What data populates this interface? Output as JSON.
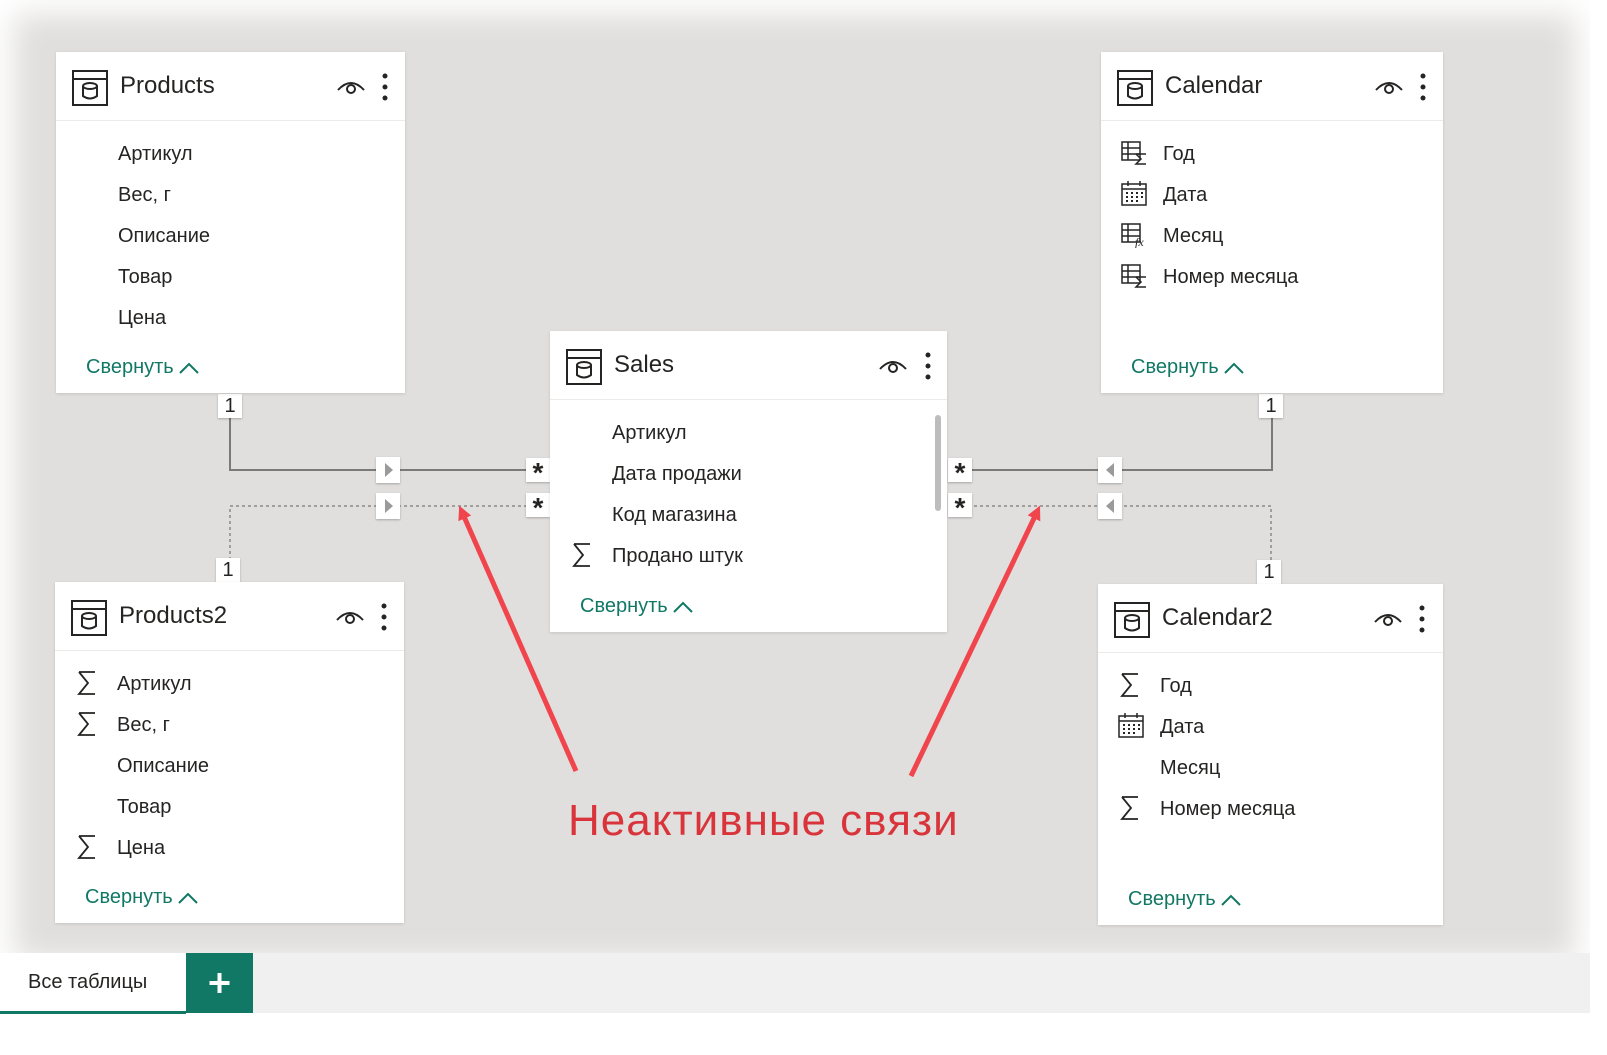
{
  "tables": {
    "products": {
      "title": "Products",
      "fields": [
        "Артикул",
        "Вес, г",
        "Описание",
        "Товар",
        "Цена"
      ],
      "field_icons": [
        "none",
        "none",
        "none",
        "none",
        "none"
      ],
      "collapse_label": "Свернуть"
    },
    "products2": {
      "title": "Products2",
      "fields": [
        "Артикул",
        "Вес, г",
        "Описание",
        "Товар",
        "Цена"
      ],
      "field_icons": [
        "sigma-icon",
        "sigma-icon",
        "none",
        "none",
        "sigma-icon"
      ],
      "collapse_label": "Свернуть"
    },
    "sales": {
      "title": "Sales",
      "fields": [
        "Артикул",
        "Дата продажи",
        "Код магазина",
        "Продано штук"
      ],
      "field_icons": [
        "none",
        "none",
        "none",
        "sigma-icon"
      ],
      "collapse_label": "Свернуть"
    },
    "calendar": {
      "title": "Calendar",
      "fields": [
        "Год",
        "Дата",
        "Месяц",
        "Номер месяца"
      ],
      "field_icons": [
        "calculated-column-sigma-icon",
        "calendar-icon",
        "calculated-column-fx-icon",
        "calculated-column-sigma-icon"
      ],
      "collapse_label": "Свернуть"
    },
    "calendar2": {
      "title": "Calendar2",
      "fields": [
        "Год",
        "Дата",
        "Месяц",
        "Номер месяца"
      ],
      "field_icons": [
        "sigma-icon",
        "calendar-icon",
        "none",
        "sigma-icon"
      ],
      "collapse_label": "Свернуть"
    }
  },
  "relationships": {
    "one_label": "1",
    "many_label": "*",
    "active_color": "#7a7a7a",
    "inactive_color": "#8a8a8a"
  },
  "annotation": {
    "text": "Неактивные связи",
    "color": "#d9343b"
  },
  "bottom_bar": {
    "tab_label": "Все таблицы",
    "add_label": "+"
  },
  "colors": {
    "accent": "#117865",
    "canvas": "#e1dfdd"
  }
}
